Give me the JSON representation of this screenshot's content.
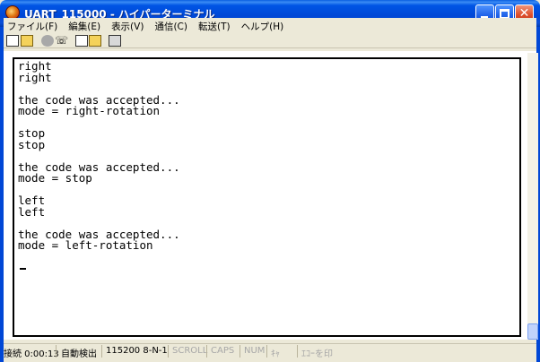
{
  "window": {
    "title": "UART_115000 - ハイパーターミナル"
  },
  "menu": {
    "items": [
      "ファイル(F)",
      "編集(E)",
      "表示(V)",
      "通信(C)",
      "転送(T)",
      "ヘルプ(H)"
    ]
  },
  "toolbar": {
    "icons": [
      "new-icon",
      "open-icon",
      "disconnect-icon",
      "call-icon",
      "send-icon",
      "receive-icon",
      "properties-icon"
    ]
  },
  "terminal": {
    "lines": [
      "right",
      "right",
      "",
      "the code was accepted...",
      "mode = right-rotation",
      "",
      "stop",
      "stop",
      "",
      "the code was accepted...",
      "mode = stop",
      "",
      "left",
      "left",
      "",
      "the code was accepted...",
      "mode = left-rotation"
    ]
  },
  "statusbar": {
    "connection": "接続 0:00:13",
    "detect": "自動検出",
    "baud": "115200 8-N-1",
    "scroll": "SCROLL",
    "caps": "CAPS",
    "num": "NUM",
    "capture": "ｷｬ",
    "echo": "ｴｺｰを印"
  },
  "colors": {
    "titlebar": "#0055e5",
    "terminal_bg": "#ffffff",
    "chrome": "#ece9d8"
  }
}
